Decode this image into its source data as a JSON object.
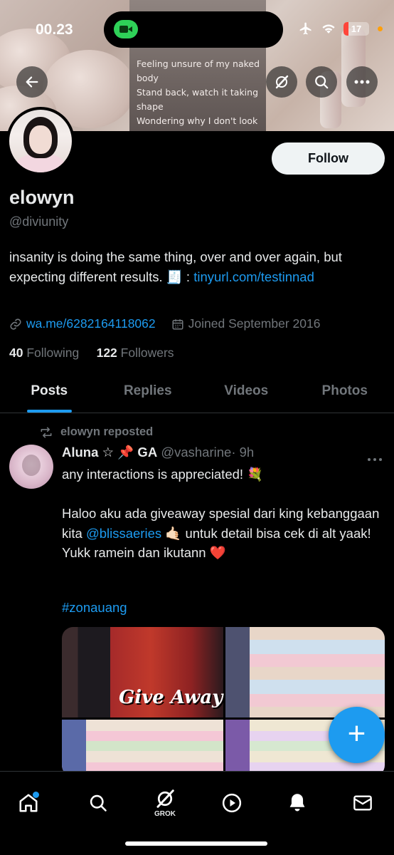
{
  "status_bar": {
    "time": "00.23",
    "battery": "17"
  },
  "banner": {
    "lyrics": [
      "Feeling unsure of my naked",
      "body",
      "Stand back, watch it taking",
      "shape",
      "Wondering why I don't look"
    ]
  },
  "profile": {
    "name": "elowyn",
    "handle": "@diviunity",
    "bio_text": "insanity is doing the same thing, over and over again, but expecting different results. 🧾 : ",
    "bio_link": "tinyurl.com/testinnad",
    "website": "wa.me/6282164118062",
    "joined": "Joined September 2016",
    "following_count": "40",
    "following_label": "Following",
    "followers_count": "122",
    "followers_label": "Followers",
    "follow_button": "Follow"
  },
  "tabs": [
    "Posts",
    "Replies",
    "Videos",
    "Photos"
  ],
  "post": {
    "repost_label": "elowyn reposted",
    "author_name": "Aluna ☆ 📌 GA",
    "author_handle": "@vasharine",
    "time": "· 9h",
    "text_part1": "any interactions is appreciated! 💐\n\nHaloo aku ada giveaway spesial dari king kebanggaan kita ",
    "mention": "@blissaeries",
    "text_part2": " 🤙🏻 untuk detail bisa cek di alt yaak! Yukk ramein dan ikutann ❤️",
    "hashtag": "#zonauang",
    "media_overlay": "Give Away"
  },
  "fab_label": "+",
  "bottom_nav": {
    "grok_label": "GROK"
  }
}
